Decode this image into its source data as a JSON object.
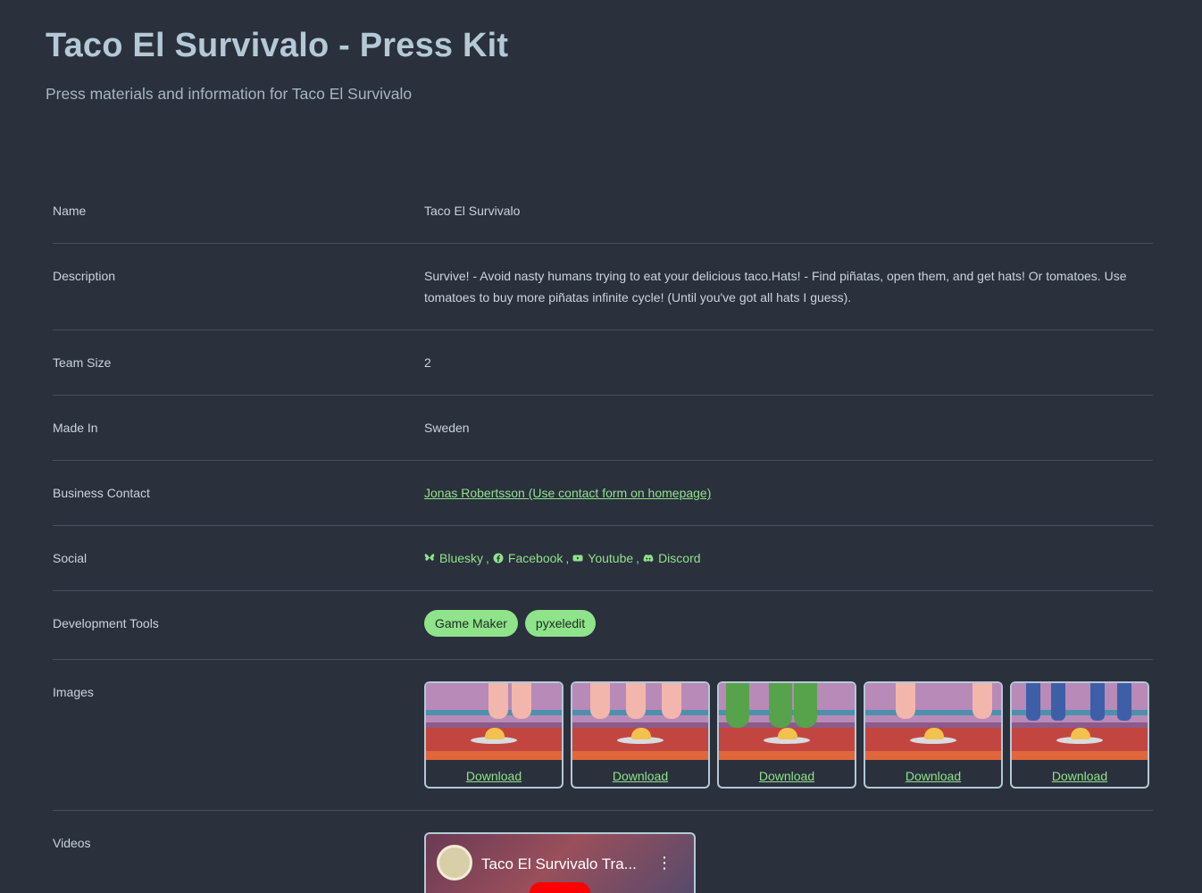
{
  "header": {
    "title": "Taco El Survivalo - Press Kit",
    "subtitle": "Press materials and information for Taco El Survivalo"
  },
  "rows": {
    "name": {
      "label": "Name",
      "value": "Taco El Survivalo"
    },
    "description": {
      "label": "Description",
      "value": "Survive! - Avoid nasty humans trying to eat your delicious taco.Hats! - Find piñatas, open them, and get hats! Or tomatoes. Use tomatoes to buy more piñatas infinite cycle! (Until you've got all hats I guess)."
    },
    "team_size": {
      "label": "Team Size",
      "value": "2"
    },
    "made_in": {
      "label": "Made In",
      "value": "Sweden"
    },
    "business_contact": {
      "label": "Business Contact",
      "value": "Jonas Robertsson (Use contact form on homepage)"
    },
    "social": {
      "label": "Social",
      "links": [
        {
          "label": "Bluesky",
          "icon": "bluesky-icon"
        },
        {
          "label": "Facebook",
          "icon": "facebook-icon"
        },
        {
          "label": "Youtube",
          "icon": "youtube-icon"
        },
        {
          "label": "Discord",
          "icon": "discord-icon"
        }
      ],
      "separator": ","
    },
    "development_tools": {
      "label": "Development Tools",
      "tools": [
        "Game Maker",
        "pyxeledit"
      ]
    },
    "images": {
      "label": "Images",
      "download_label": "Download",
      "count": 5
    },
    "videos": {
      "label": "Videos",
      "video_title": "Taco El Survivalo Tra...",
      "menu_glyph": "⋮"
    }
  },
  "colors": {
    "background": "#2a303c",
    "accent": "#8fe38a",
    "title": "#b3c9d6",
    "divider": "#47505d"
  }
}
